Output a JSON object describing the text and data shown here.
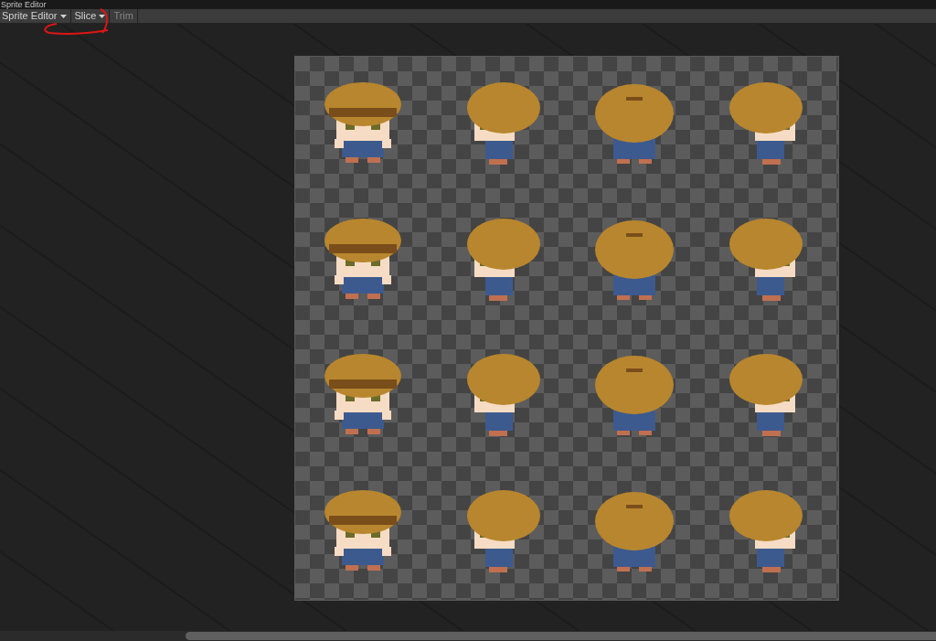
{
  "window": {
    "title": "Sprite Editor"
  },
  "toolbar": [
    {
      "label": "Sprite Editor",
      "kind": "dropdown",
      "disabled": false
    },
    {
      "label": "Slice",
      "kind": "dropdown",
      "disabled": false
    },
    {
      "label": "Trim",
      "kind": "button",
      "disabled": true
    }
  ],
  "sprite_sheet": {
    "rows": [
      [
        {
          "kind": "front"
        },
        {
          "kind": "left"
        },
        {
          "kind": "back"
        },
        {
          "kind": "right"
        }
      ],
      [
        {
          "kind": "front"
        },
        {
          "kind": "left"
        },
        {
          "kind": "back"
        },
        {
          "kind": "right"
        }
      ],
      [
        {
          "kind": "front"
        },
        {
          "kind": "left"
        },
        {
          "kind": "back"
        },
        {
          "kind": "right"
        }
      ],
      [
        {
          "kind": "front"
        },
        {
          "kind": "left"
        },
        {
          "kind": "back"
        },
        {
          "kind": "right"
        }
      ]
    ]
  }
}
